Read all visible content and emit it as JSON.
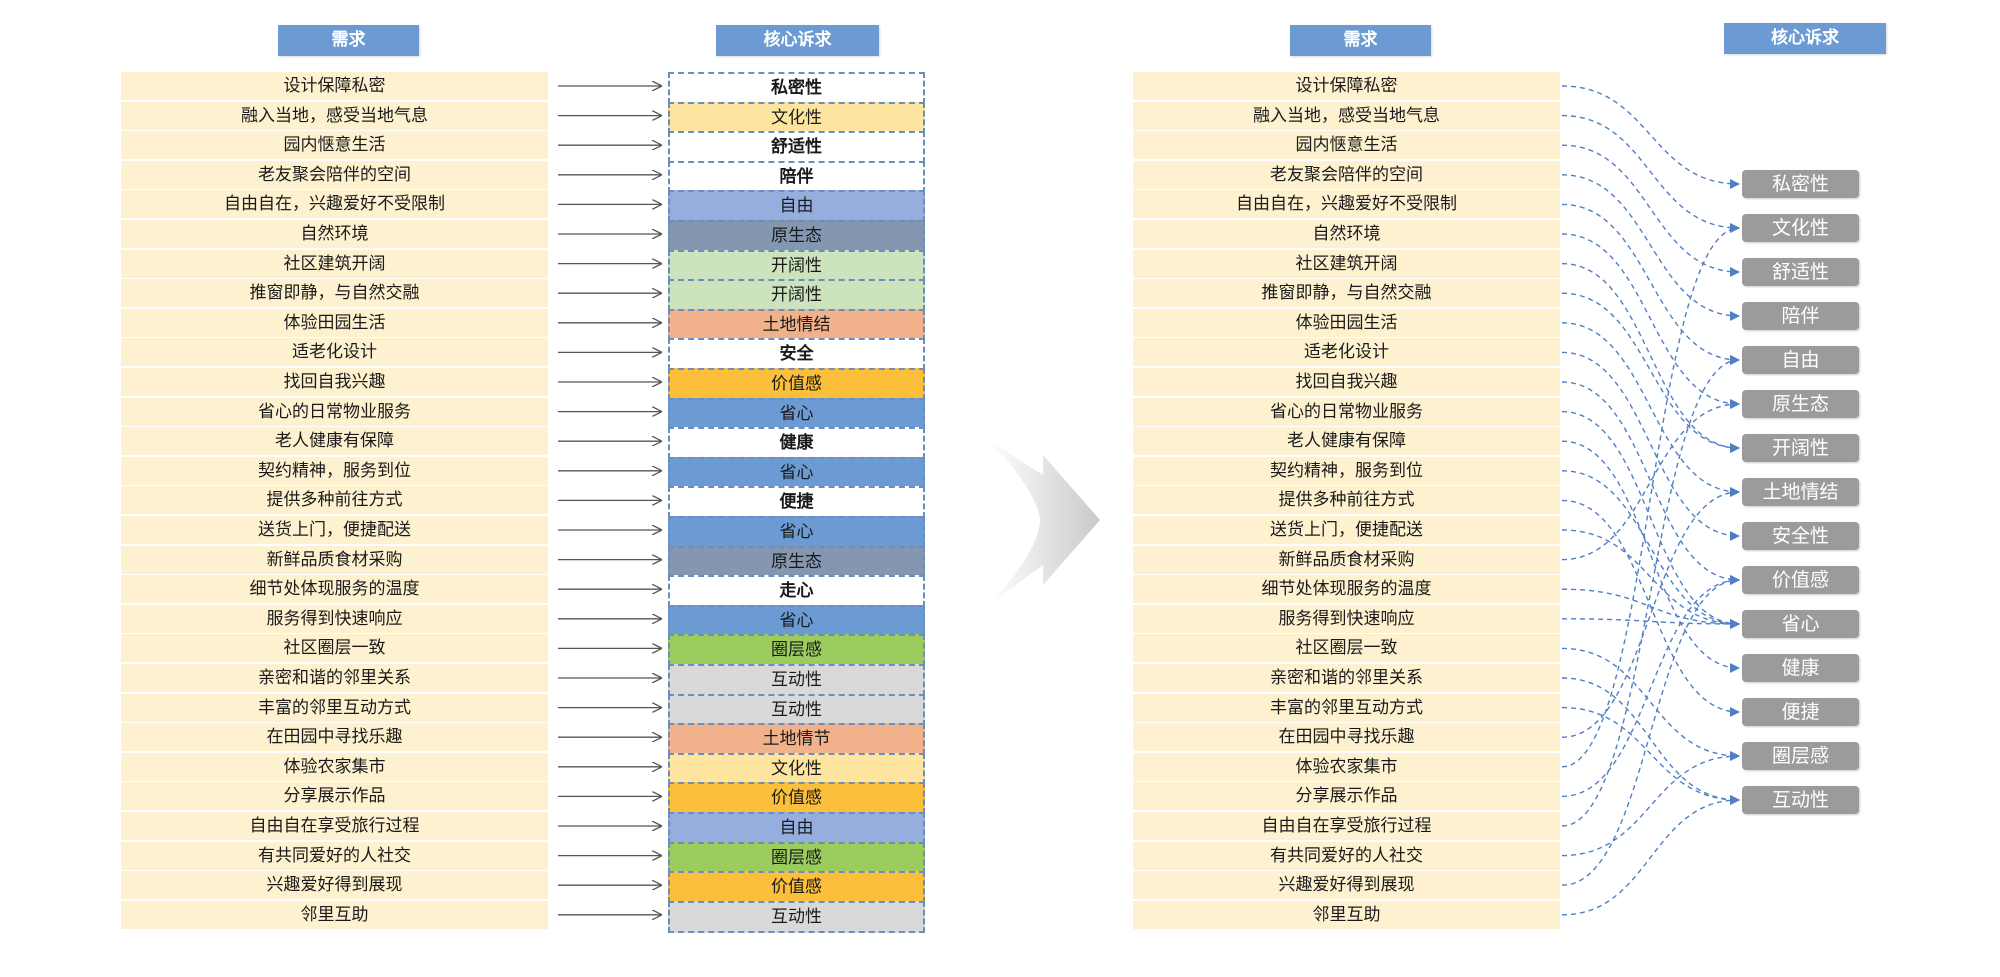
{
  "headers": {
    "demand": "需求",
    "core": "核心诉求"
  },
  "demands": [
    "设计保障私密",
    "融入当地，感受当地气息",
    "园内惬意生活",
    "老友聚会陪伴的空间",
    "自由自在，兴趣爱好不受限制",
    "自然环境",
    "社区建筑开阔",
    "推窗即静，与自然交融",
    "体验田园生活",
    "适老化设计",
    "找回自我兴趣",
    "省心的日常物业服务",
    "老人健康有保障",
    "契约精神，服务到位",
    "提供多种前往方式",
    "送货上门，便捷配送",
    "新鲜品质食材采购",
    "细节处体现服务的温度",
    "服务得到快速响应",
    "社区圈层一致",
    "亲密和谐的邻里关系",
    "丰富的邻里互动方式",
    "在田园中寻找乐趣",
    "体验农家集市",
    "分享展示作品",
    "自由自在享受旅行过程",
    "有共同爱好的人社交",
    "兴趣爱好得到展现",
    "邻里互助"
  ],
  "core_cells": [
    {
      "label": "私密性",
      "color": "#ffffff"
    },
    {
      "label": "文化性",
      "color": "#fde5a0"
    },
    {
      "label": "舒适性",
      "color": "#ffffff"
    },
    {
      "label": "陪伴",
      "color": "#ffffff"
    },
    {
      "label": "自由",
      "color": "#95aedd"
    },
    {
      "label": "原生态",
      "color": "#8496b0"
    },
    {
      "label": "开阔性",
      "color": "#cde3bd"
    },
    {
      "label": "开阔性",
      "color": "#cde3bd"
    },
    {
      "label": "土地情结",
      "color": "#f1b18a"
    },
    {
      "label": "安全",
      "color": "#ffffff"
    },
    {
      "label": "价值感",
      "color": "#fbbf3c"
    },
    {
      "label": "省心",
      "color": "#6b9bd2"
    },
    {
      "label": "健康",
      "color": "#ffffff"
    },
    {
      "label": "省心",
      "color": "#6b9bd2"
    },
    {
      "label": "便捷",
      "color": "#ffffff"
    },
    {
      "label": "省心",
      "color": "#6b9bd2"
    },
    {
      "label": "原生态",
      "color": "#8496b0"
    },
    {
      "label": "走心",
      "color": "#ffffff"
    },
    {
      "label": "省心",
      "color": "#6b9bd2"
    },
    {
      "label": "圈层感",
      "color": "#9ccc5e"
    },
    {
      "label": "互动性",
      "color": "#d9d9d9"
    },
    {
      "label": "互动性",
      "color": "#d9d9d9"
    },
    {
      "label": "土地情节",
      "color": "#f1b18a"
    },
    {
      "label": "文化性",
      "color": "#fde5a0"
    },
    {
      "label": "价值感",
      "color": "#fbbf3c"
    },
    {
      "label": "自由",
      "color": "#95aedd"
    },
    {
      "label": "圈层感",
      "color": "#9ccc5e"
    },
    {
      "label": "价值感",
      "color": "#fbbf3c"
    },
    {
      "label": "互动性",
      "color": "#d9d9d9"
    }
  ],
  "core_categories": [
    "私密性",
    "文化性",
    "舒适性",
    "陪伴",
    "自由",
    "原生态",
    "开阔性",
    "土地情结",
    "安全性",
    "价值感",
    "省心",
    "健康",
    "便捷",
    "圈层感",
    "互动性"
  ],
  "mapping": [
    0,
    1,
    2,
    3,
    4,
    5,
    6,
    6,
    7,
    8,
    9,
    10,
    11,
    10,
    12,
    10,
    5,
    10,
    10,
    13,
    14,
    14,
    7,
    1,
    9,
    4,
    13,
    9,
    14
  ],
  "colors": {
    "header": "#6b9bd2",
    "demand_bg": "#fdf1cf",
    "pill": "#9b9b9b",
    "connector": "#4f7fc4"
  }
}
